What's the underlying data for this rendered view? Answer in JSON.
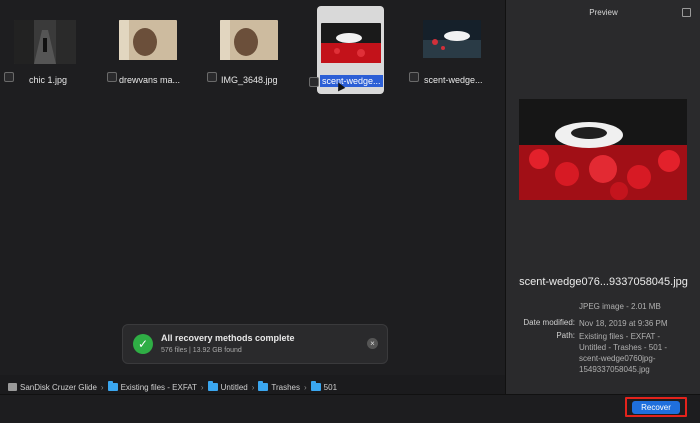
{
  "files": [
    {
      "name": "chic 1.jpg",
      "selected": false
    },
    {
      "name": "drewvans ma...",
      "selected": false
    },
    {
      "name": "IMG_3648.jpg",
      "selected": false
    },
    {
      "name": "scent-wedge...",
      "selected": true
    },
    {
      "name": "scent-wedge...",
      "selected": false
    }
  ],
  "toast": {
    "title": "All recovery methods complete",
    "subtitle": "576 files | 13.92 GB found"
  },
  "breadcrumb": [
    "SanDisk Cruzer Glide",
    "Existing files - EXFAT",
    "Untitled",
    "Trashes",
    "501"
  ],
  "preview": {
    "title": "Preview",
    "filename": "scent-wedge076...9337058045.jpg",
    "type_size": "JPEG image - 2.01 MB",
    "date_label": "Date modified:",
    "date_value": "Nov 18, 2019 at 9:36 PM",
    "path_label": "Path:",
    "path_value": "Existing files - EXFAT - Untitled - Trashes - 501 - scent-wedge0760jpg-1549337058045.jpg"
  },
  "actions": {
    "recover": "Recover"
  },
  "colors": {
    "accent": "#1f6fdd",
    "highlight": "#e3231c",
    "success": "#2fae45",
    "folder": "#3aa6ef"
  }
}
